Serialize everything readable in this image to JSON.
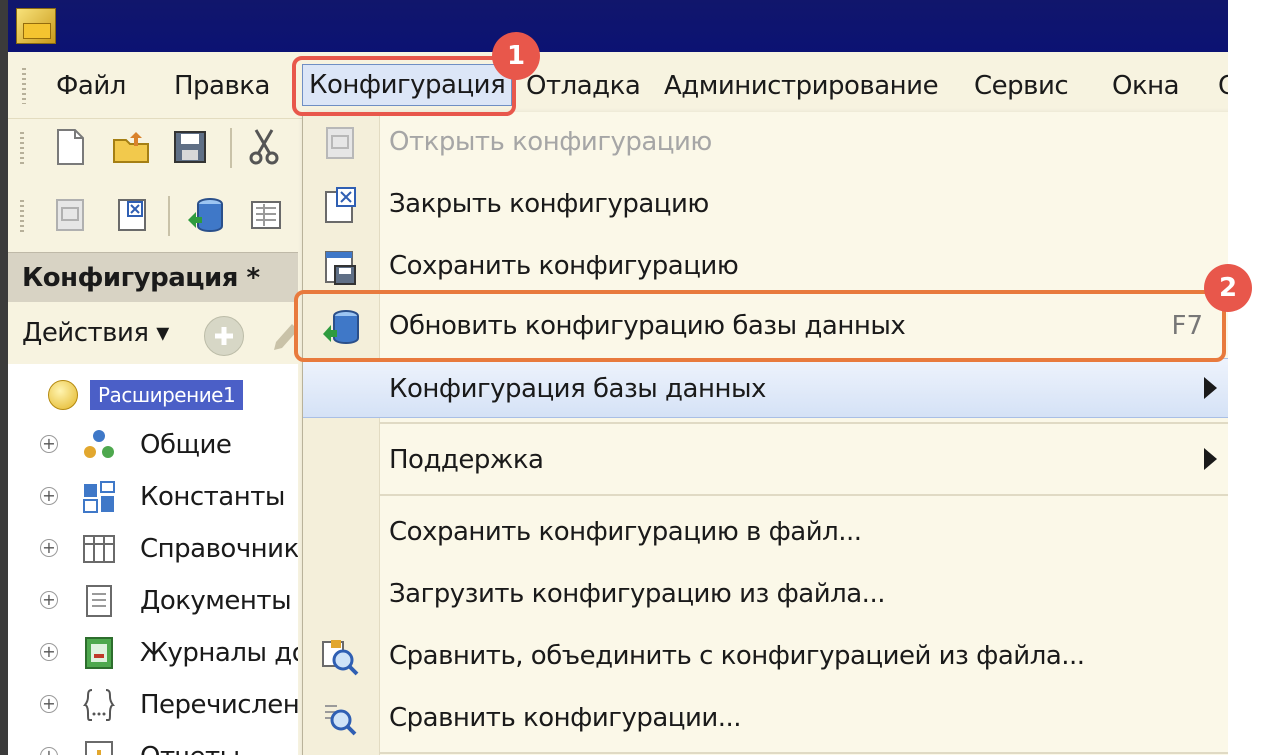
{
  "window": {
    "app_logo": "1c-logo-icon",
    "title": ""
  },
  "menubar": {
    "items": [
      {
        "label": "Файл"
      },
      {
        "label": "Правка"
      },
      {
        "label": "Конфигурация"
      },
      {
        "label": "Отладка"
      },
      {
        "label": "Администрирование"
      },
      {
        "label": "Сервис"
      },
      {
        "label": "Окна"
      },
      {
        "label": "С"
      }
    ]
  },
  "toolbar": {
    "row1_icons": [
      "new-document-icon",
      "open-folder-icon",
      "save-icon",
      "cut-icon"
    ],
    "row2_icons": [
      "open-config-icon",
      "close-config-icon",
      "update-database-icon",
      "properties-icon"
    ]
  },
  "left_panel": {
    "title": "Конфигурация *",
    "actions_label": "Действия ▾",
    "tree": [
      {
        "label": "Расширение1",
        "icon": "extension-icon",
        "selected": true
      },
      {
        "label": "Общие",
        "icon": "common-icon"
      },
      {
        "label": "Константы",
        "icon": "constants-icon"
      },
      {
        "label": "Справочник",
        "icon": "catalogs-icon"
      },
      {
        "label": "Документы",
        "icon": "documents-icon"
      },
      {
        "label": "Журналы до",
        "icon": "journals-icon"
      },
      {
        "label": "Перечислен",
        "icon": "enums-icon"
      },
      {
        "label": "Отчеты",
        "icon": "reports-icon"
      }
    ]
  },
  "dropdown": {
    "items": [
      {
        "label": "Открыть конфигурацию",
        "icon": "open-config-icon",
        "disabled": true
      },
      {
        "label": "Закрыть конфигурацию",
        "icon": "close-config-icon"
      },
      {
        "label": "Сохранить конфигурацию",
        "icon": "save-config-icon"
      },
      {
        "label": "Обновить конфигурацию базы данных",
        "icon": "update-database-icon",
        "shortcut": "F7"
      },
      {
        "label": "Конфигурация базы данных",
        "submenu": true
      },
      {
        "label": "Поддержка",
        "submenu": true
      },
      {
        "label": "Сохранить конфигурацию в файл..."
      },
      {
        "label": "Загрузить конфигурацию из файла..."
      },
      {
        "label": "Сравнить, объединить с конфигурацией из файла...",
        "icon": "compare-merge-icon"
      },
      {
        "label": "Сравнить конфигурации...",
        "icon": "compare-icon"
      }
    ]
  },
  "callouts": [
    {
      "number": "1"
    },
    {
      "number": "2"
    }
  ],
  "colors": {
    "titlebar": "#0b1273",
    "menu_background": "#fbf8e8",
    "highlight": "#d5e2f6",
    "callout": "#e8574b",
    "tree_selection": "#4b5fc7"
  }
}
